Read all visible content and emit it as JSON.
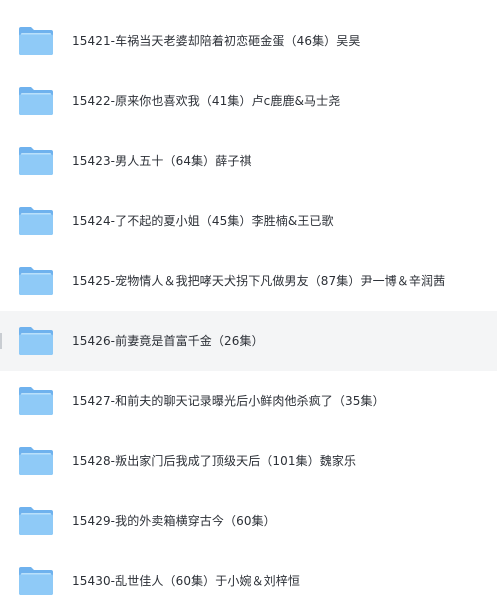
{
  "file_list": {
    "items": [
      {
        "label": "15421-车祸当天老婆却陪着初恋砸金蛋（46集）吴昊",
        "icon": "folder-icon",
        "hovered": false
      },
      {
        "label": "15422-原来你也喜欢我（41集）卢c鹿鹿&马士尧",
        "icon": "folder-icon",
        "hovered": false
      },
      {
        "label": "15423-男人五十（64集）薛子祺",
        "icon": "folder-icon",
        "hovered": false
      },
      {
        "label": "15424-了不起的夏小姐（45集）李胜楠&王已歌",
        "icon": "folder-icon",
        "hovered": false
      },
      {
        "label": "15425-宠物情人＆我把哮天犬拐下凡做男友（87集）尹一博＆辛润茜",
        "icon": "folder-icon",
        "hovered": false
      },
      {
        "label": "15426-前妻竟是首富千金（26集）",
        "icon": "folder-icon",
        "hovered": true
      },
      {
        "label": "15427-和前夫的聊天记录曝光后小鲜肉他杀疯了（35集）",
        "icon": "folder-icon",
        "hovered": false
      },
      {
        "label": "15428-叛出家门后我成了顶级天后（101集）魏家乐",
        "icon": "folder-icon",
        "hovered": false
      },
      {
        "label": "15429-我的外卖箱横穿古今（60集）",
        "icon": "folder-icon",
        "hovered": false
      },
      {
        "label": "15430-乱世佳人（60集）于小婉＆刘梓恒",
        "icon": "folder-icon",
        "hovered": false
      }
    ]
  },
  "colors": {
    "folder_back": "#6fb2ee",
    "folder_front": "#8fcaf7",
    "folder_top": "#b9e0fb",
    "text": "#2b2f36",
    "hover_background": "#f4f5f6"
  }
}
